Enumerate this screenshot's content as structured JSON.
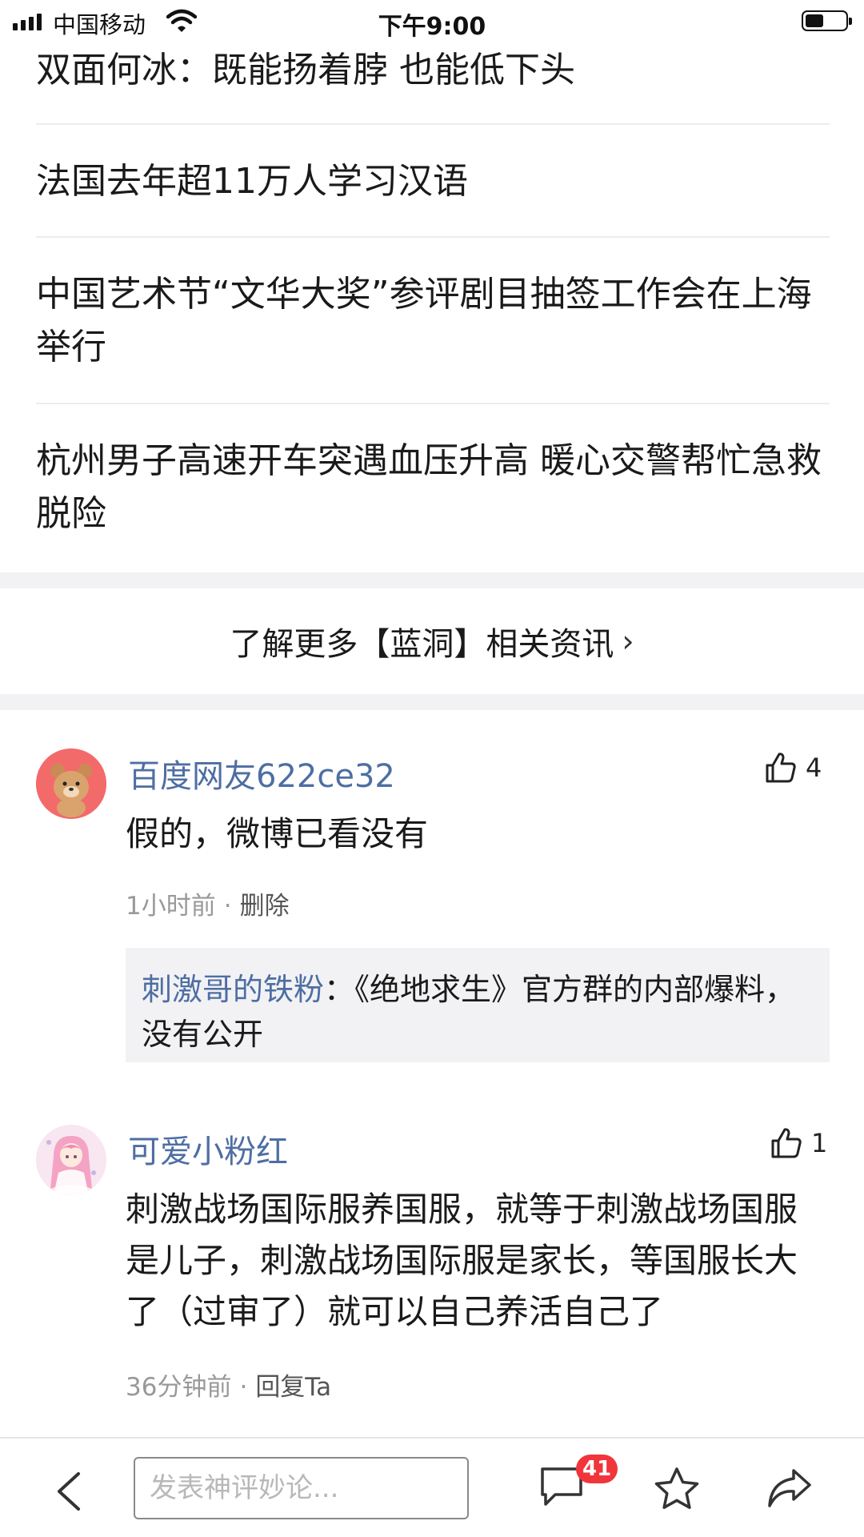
{
  "status_bar": {
    "carrier": "中国移动",
    "time": "下午9:00",
    "battery_level": 0.45
  },
  "news": [
    {
      "title": "双面何冰：既能扬着脖 也能低下头"
    },
    {
      "title": "法国去年超11万人学习汉语"
    },
    {
      "title": "中国艺术节“文华大奖”参评剧目抽签工作会在上海举行"
    },
    {
      "title": "杭州男子高速开车突遇血压升高 暖心交警帮忙急救脱险"
    }
  ],
  "more_link": {
    "label": "了解更多【蓝洞】相关资讯",
    "chevron": "›"
  },
  "comments": [
    {
      "username": "百度网友622ce32",
      "likes": "4",
      "text": "假的，微博已看没有",
      "time": "1小时前",
      "action": "删除",
      "reply": {
        "user": "刺激哥的铁粉",
        "separator": "：",
        "text": "《绝地求生》官方群的内部爆料，没有公开"
      }
    },
    {
      "username": "可爱小粉红",
      "likes": "1",
      "text": "刺激战场国际服养国服，就等于刺激战场国服是儿子，刺激战场国际服是家长，等国服长大了（过审了）就可以自己养活自己了",
      "time": "36分钟前",
      "action": "回复Ta"
    }
  ],
  "bottom_bar": {
    "input_placeholder": "发表神评妙论...",
    "comment_count": "41",
    "icons": [
      "back-arrow-icon",
      "comment-bubble-icon",
      "star-icon",
      "share-icon"
    ]
  },
  "colors": {
    "username": "#4e6ea3",
    "badge": "#f1353b",
    "band": "#f2f2f4"
  }
}
